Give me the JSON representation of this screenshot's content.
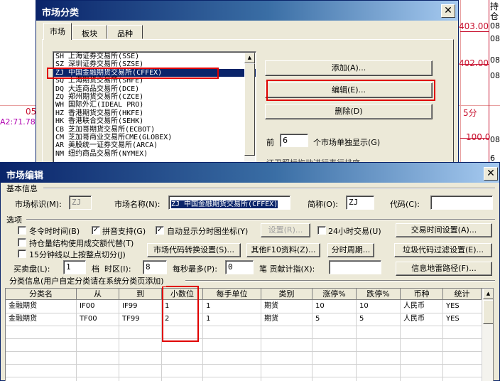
{
  "background": {
    "labels": [
      "持",
      "仓",
      "403.00",
      "08",
      "08",
      "402.00",
      "08",
      "08",
      "5分",
      "100.0",
      "08",
      "6",
      "05",
      "A2:71.784"
    ]
  },
  "market_dialog": {
    "title": "市场分类",
    "tabs": [
      "市场",
      "板块",
      "品种"
    ],
    "markets": [
      "SH 上海证券交易所(SSE)",
      "SZ 深圳证券交易所(SZSE)",
      "ZJ 中国金融期货交易所(CFFEX)",
      "SQ 上海期货交易所(SHFE)",
      "DQ 大连商品交易所(DCE)",
      "ZQ 郑州期货交易所(CZCE)",
      "WH 国际外汇(IDEAL PRO)",
      "HZ 香港期货交易所(HKFE)",
      "HK 香港联合交易所(SEHK)",
      "CB 芝加哥期货交易所(ECBOT)",
      "CM 芝加哥商业交易所CME(GLOBEX)",
      "AR 美股统一证券交易所(ARCA)",
      "NM 纽约商品交易所(NYMEX)"
    ],
    "selected_index": 2,
    "add_button": "添加(A)...",
    "edit_button": "编辑(E)...",
    "delete_button": "删除(D)",
    "front_label": "前",
    "front_value": "6",
    "front_suffix": "个市场单独显示(G)",
    "partial_text": "证卫照标拖动进行表行排序"
  },
  "edit_dialog": {
    "title": "市场编辑",
    "basic_info_label": "基本信息",
    "market_id_label": "市场标识(M):",
    "market_id_value": "ZJ",
    "market_name_label": "市场名称(N):",
    "market_name_value": "ZJ 中国金融期货交易所(CFFEX)",
    "short_name_label": "简称(O):",
    "short_name_value": "ZJ",
    "code_label": "代码(C):",
    "code_value": "",
    "options_label": "选项",
    "checkboxes": [
      {
        "label": "冬令时时间(B)",
        "checked": false
      },
      {
        "label": "拼音支持(G)",
        "checked": true
      },
      {
        "label": "自动显示分时图坐标(Y)",
        "checked": true
      },
      {
        "label": "24小时交易(U)",
        "checked": false
      },
      {
        "label": "持仓量结构使用成交额代替(T)",
        "checked": false
      },
      {
        "label": "15分钟线以上按整点切分(J)",
        "checked": false
      }
    ],
    "settings_button": "设置(R)...",
    "trade_time_button": "交易时间设置(A)...",
    "code_convert_button": "市场代码转换设置(S)...",
    "f10_button": "其他F10资料(Z)...",
    "tick_period_button": "分时周期...",
    "junk_filter_button": "垃圾代码过滤设置(E)...",
    "bid_ask_label": "买卖盘(L):",
    "bid_ask_value": "1",
    "tier_label": "档",
    "timezone_label": "时区(I):",
    "timezone_value": "8",
    "per_sec_label": "每秒最多(P):",
    "per_sec_value": "0",
    "contrib_label": "笔 贡献计指(X):",
    "contrib_value": "",
    "info_mine_button": "信息地雷路径(F)...",
    "classify_label": "分类信息(用户自定分类请在系统分类页添加)",
    "columns": [
      "分类名",
      "从",
      "到",
      "小数位",
      "每手单位",
      "类别",
      "涨停%",
      "跌停%",
      "币种",
      "统计"
    ],
    "rows": [
      [
        "金融期货",
        "IF00",
        "IF99",
        "1",
        "1",
        "期货",
        "10",
        "10",
        "人民币",
        "YES"
      ],
      [
        "金融期货",
        "TF00",
        "TF99",
        "2",
        "1",
        "期货",
        "5",
        "5",
        "人民币",
        "YES"
      ]
    ]
  },
  "colors": {
    "titlebar": "#0a246a",
    "highlight": "#e00000",
    "chart": "#c8102e"
  }
}
